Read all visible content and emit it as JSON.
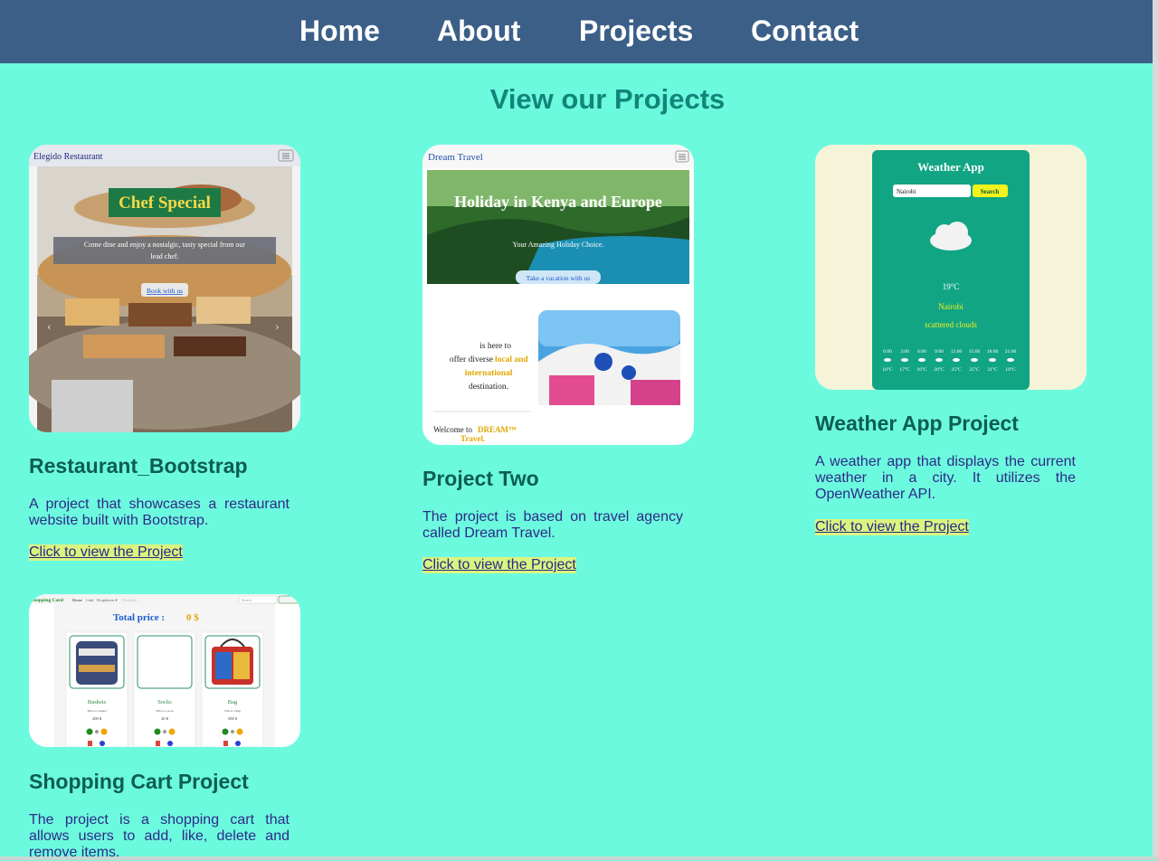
{
  "nav": {
    "items": [
      {
        "label": "Home"
      },
      {
        "label": "About"
      },
      {
        "label": "Projects"
      },
      {
        "label": "Contact"
      }
    ]
  },
  "main": {
    "heading": "View our Projects",
    "projects": [
      {
        "title": "Restaurant_Bootstrap",
        "description": "A project that showcases a restaurant website built with Bootstrap.",
        "link": "Click to view the Project",
        "thumb": {
          "brand": "Elegido Restaurant",
          "headline": "Chef Special",
          "caption_line1": "Come dine and enjoy a nostalgic, tasty special from our",
          "caption_line2": "lead chef.",
          "button": "Book with us"
        }
      },
      {
        "title": "Project Two",
        "description": "The project is based on travel agency called Dream Travel.",
        "link": "Click to view the Project",
        "thumb": {
          "brand": "Dream Travel",
          "headline": "Holiday in Kenya and Europe",
          "tagline": "Your Amazing Holiday Choice.",
          "button": "Take a vacation with us",
          "text_1": "is here to",
          "text_2": "offer diverse",
          "text_3": "local and",
          "text_4": "international",
          "text_5": "destination.",
          "welcome": "Welcome to",
          "welcome_brand_1": "DREAM™",
          "welcome_brand_2": "Travel."
        }
      },
      {
        "title": "Weather App Project",
        "description": "A weather app that displays the current weather in a city. It utilizes the OpenWeather API.",
        "link": "Click to view the Project",
        "thumb": {
          "app_title": "Weather App",
          "input_value": "Nairobi",
          "button": "Search",
          "temp": "19°C",
          "city": "Nairobi",
          "condition": "scattered clouds",
          "hours": [
            "0:00",
            "3:00",
            "6:00",
            "9:00",
            "12:00",
            "15:00",
            "18:00",
            "21:00"
          ],
          "temps": [
            "18°C",
            "17°C",
            "16°C",
            "20°C",
            "25°C",
            "25°C",
            "21°C",
            "18°C"
          ]
        }
      },
      {
        "title": "Shopping Cart Project",
        "description": "The project is a shopping cart that allows users to add, like, delete and remove items.",
        "thumb": {
          "brand": "Shopping Card",
          "nav_items": [
            "Home",
            "Link",
            "Dropdown ▾",
            "Disabled"
          ],
          "search_placeholder": "Search",
          "total_label": "Total price :",
          "total_value": "0 $",
          "items": [
            {
              "name": "Baskets",
              "desc": "This is a basket",
              "price": "200 $"
            },
            {
              "name": "Socks",
              "desc": "This is a sock",
              "price": "20 $"
            },
            {
              "name": "Bag",
              "desc": "This is a Bag",
              "price": "500 $"
            }
          ]
        }
      }
    ]
  },
  "colors": {
    "background": "#6cfadf",
    "nav": "#3b5f87",
    "heading": "#12857a",
    "card_title": "#0e5d52",
    "description": "#2e2a86",
    "link_highlight": "#dbf47f"
  }
}
